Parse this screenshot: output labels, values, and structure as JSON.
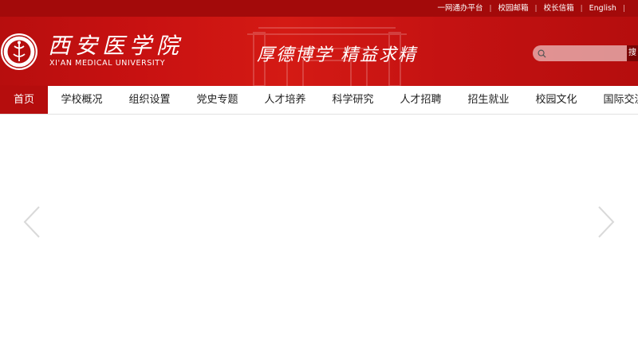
{
  "topbar": {
    "links": [
      "一网通办平台",
      "校园邮箱",
      "校长信箱",
      "English"
    ]
  },
  "header": {
    "logo_cn": "西安医学院",
    "logo_en": "XI'AN MEDICAL UNIVERSITY",
    "motto": "厚德博学 精益求精",
    "search": {
      "placeholder": "",
      "button_label": "搜"
    }
  },
  "nav": {
    "active_index": 0,
    "items": [
      {
        "label": "首页"
      },
      {
        "label": "学校概况"
      },
      {
        "label": "组织设置"
      },
      {
        "label": "党史专题"
      },
      {
        "label": "人才培养"
      },
      {
        "label": "科学研究"
      },
      {
        "label": "人才招聘"
      },
      {
        "label": "招生就业"
      },
      {
        "label": "校园文化"
      },
      {
        "label": "国际交流"
      }
    ]
  },
  "colors": {
    "brand_red": "#b50d0d",
    "topbar_red": "#a30a0a",
    "active_nav": "#b50d0d"
  },
  "icons": {
    "emblem": "university-emblem-icon",
    "search": "search-icon",
    "prev": "chevron-left-icon",
    "next": "chevron-right-icon"
  }
}
